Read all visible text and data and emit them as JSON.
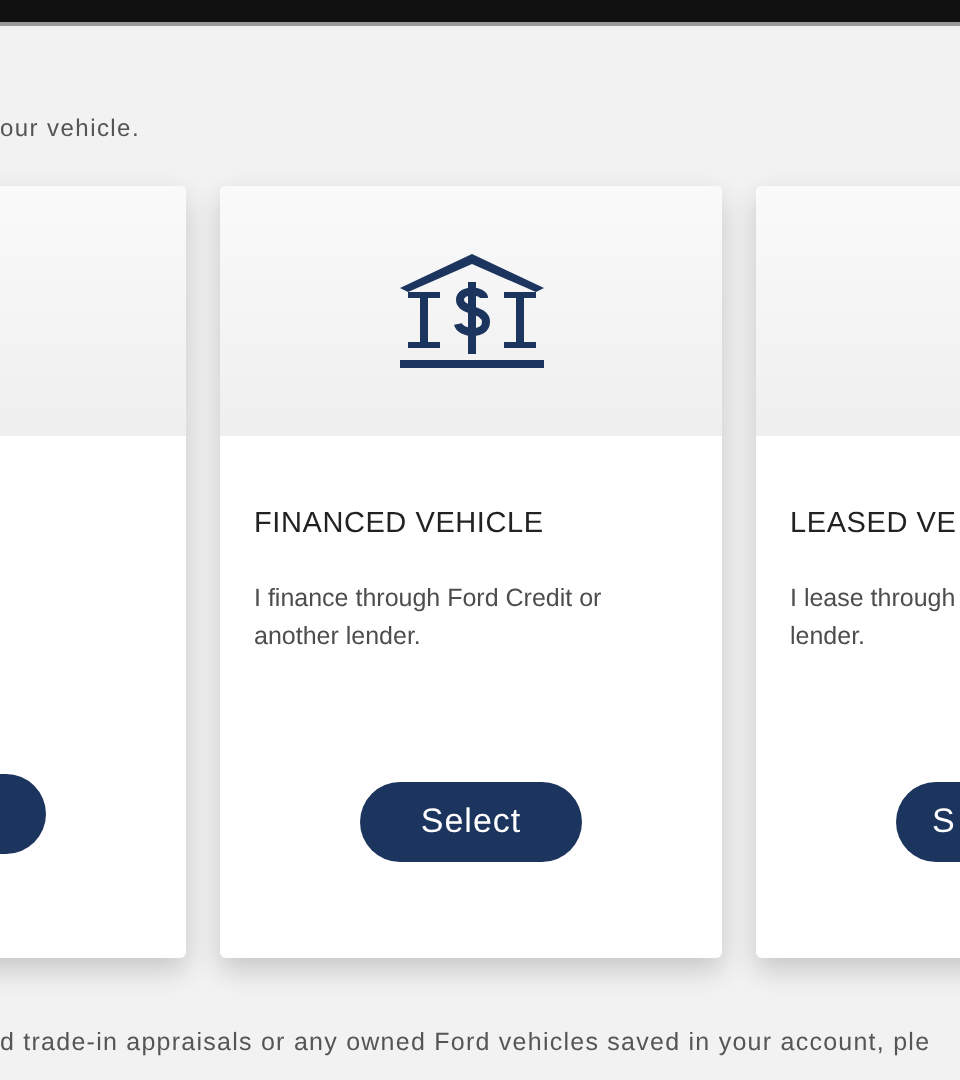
{
  "intro_text": "our vehicle.",
  "cards": [
    {
      "kind": "left"
    },
    {
      "kind": "center",
      "title": "FINANCED VEHICLE",
      "description": "I finance through Ford Credit or another lender.",
      "button_label": "Select"
    },
    {
      "kind": "right",
      "title": "LEASED VE",
      "description_lines": [
        "I lease through",
        "lender."
      ],
      "button_label": "S"
    }
  ],
  "footer_text": "d trade-in appraisals or any owned Ford vehicles saved in your account, ple"
}
